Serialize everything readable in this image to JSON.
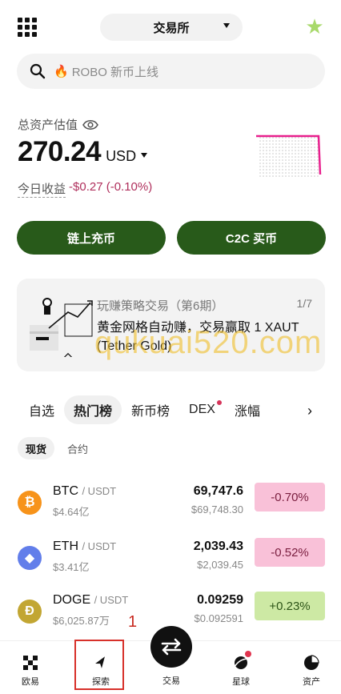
{
  "header": {
    "exchange_label": "交易所",
    "star_icon": "star-icon"
  },
  "search": {
    "placeholder": "ROBO 新币上线"
  },
  "assets": {
    "label": "总资产估值",
    "value": "270.24",
    "currency": "USD",
    "pnl_label": "今日收益",
    "pnl_value": "-$0.27 (-0.10%)"
  },
  "actions": {
    "deposit": "链上充币",
    "c2c": "C2C 买币"
  },
  "promo": {
    "title": "玩赚策略交易（第6期）",
    "page": "1/7",
    "text": "黄金网格自动赚，交易赢取 1 XAUT (Tether Gold)"
  },
  "market_tabs": [
    {
      "label": "自选",
      "active": false,
      "dot": false
    },
    {
      "label": "热门榜",
      "active": true,
      "dot": false
    },
    {
      "label": "新币榜",
      "active": false,
      "dot": false
    },
    {
      "label": "DEX",
      "active": false,
      "dot": true
    },
    {
      "label": "涨幅",
      "active": false,
      "dot": false
    }
  ],
  "sub_tabs": [
    {
      "label": "现货",
      "active": true
    },
    {
      "label": "合约",
      "active": false
    }
  ],
  "tickers": [
    {
      "base": "BTC",
      "quote": "/ USDT",
      "volume": "$4.64亿",
      "price": "69,747.6",
      "fiat": "$69,748.30",
      "change": "-0.70%",
      "dir": "down",
      "color": "#f7931a",
      "glyph": "₿"
    },
    {
      "base": "ETH",
      "quote": "/ USDT",
      "volume": "$3.41亿",
      "price": "2,039.43",
      "fiat": "$2,039.45",
      "change": "-0.52%",
      "dir": "down",
      "color": "#627eea",
      "glyph": "◆"
    },
    {
      "base": "DOGE",
      "quote": "/ USDT",
      "volume": "$6,025.87万",
      "price": "0.09259",
      "fiat": "$0.092591",
      "change": "+0.23%",
      "dir": "up",
      "color": "#c2a633",
      "glyph": "Ð"
    }
  ],
  "annotation": {
    "number": "1"
  },
  "watermark": "qukuai520.com",
  "tabbar": {
    "home": "欧易",
    "explore": "探索",
    "trade": "交易",
    "planet": "星球",
    "assets": "资产"
  }
}
